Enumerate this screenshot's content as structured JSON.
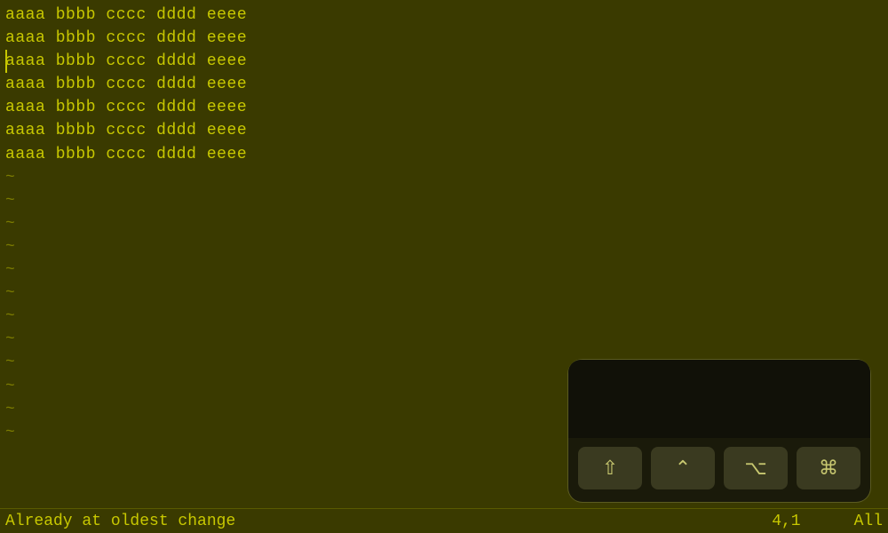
{
  "editor": {
    "lines": [
      "aaaa bbbb cccc dddd eeee",
      "aaaa bbbb cccc dddd eeee",
      "aaaa bbbb cccc dddd eeee",
      "aaaa bbbb cccc dddd eeee",
      "aaaa bbbb cccc dddd eeee",
      "aaaa bbbb cccc dddd eeee",
      "aaaa bbbb cccc dddd eeee"
    ],
    "tilde_lines": 12,
    "cursor_line": 2,
    "cursor_col": 0
  },
  "status": {
    "message": "Already at oldest change",
    "position": "4,1",
    "view": "All"
  },
  "keyboard": {
    "buttons": [
      {
        "label": "⇧",
        "name": "shift-key"
      },
      {
        "label": "⌃",
        "name": "ctrl-key"
      },
      {
        "label": "⌥",
        "name": "alt-key"
      },
      {
        "label": "⌘",
        "name": "cmd-key"
      }
    ]
  }
}
